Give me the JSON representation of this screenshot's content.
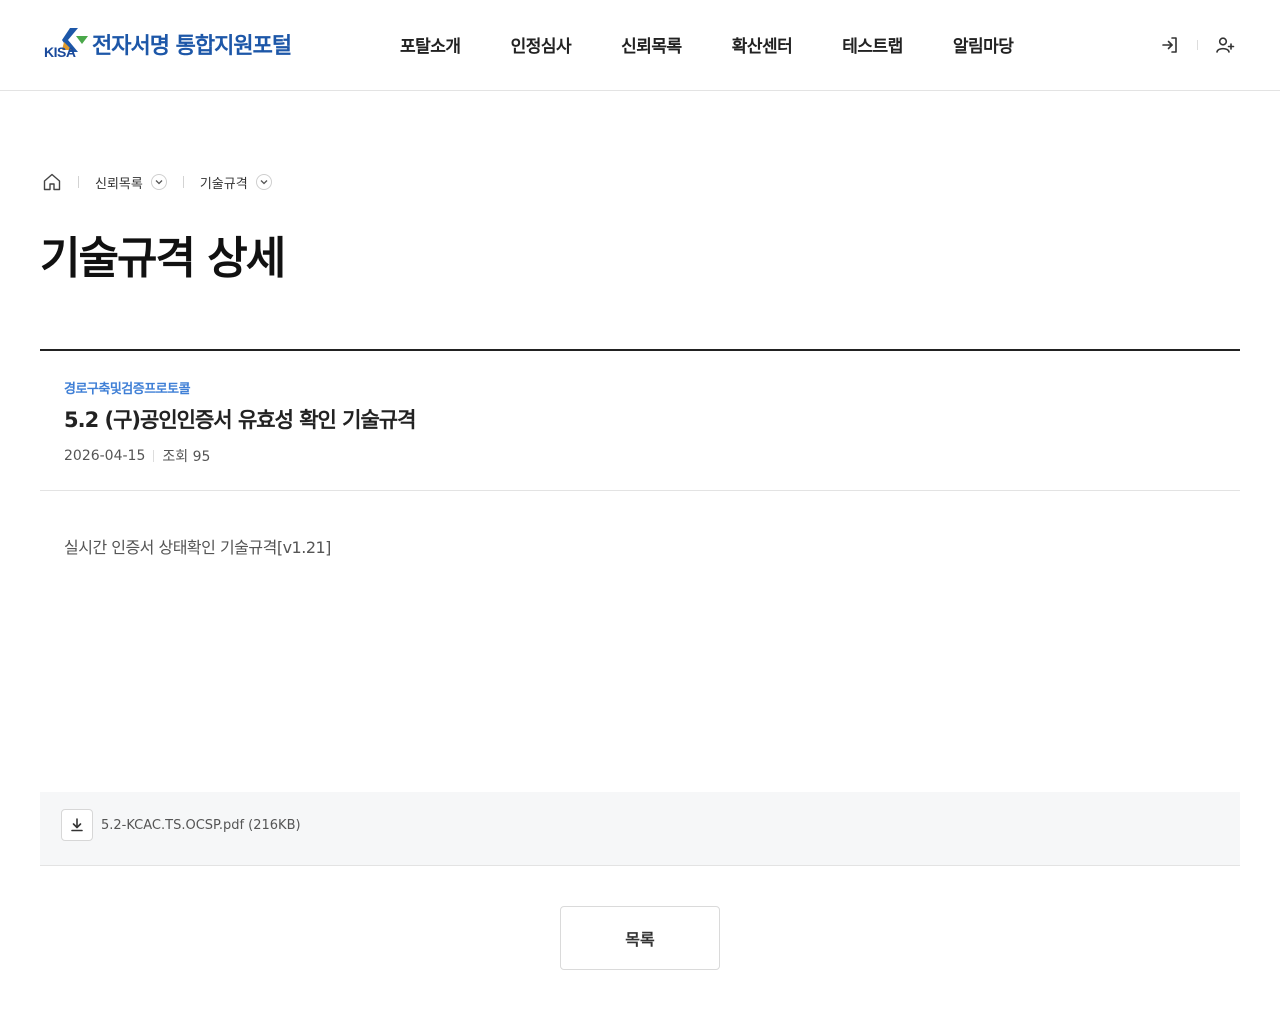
{
  "header": {
    "logo_kisa": "KISA",
    "logo_text": "전자서명 통합지원포털",
    "nav": [
      "포탈소개",
      "인정심사",
      "신뢰목록",
      "확산센터",
      "테스트랩",
      "알림마당"
    ],
    "icons": {
      "login": "login-icon",
      "signup": "user-plus-icon"
    }
  },
  "breadcrumb": {
    "home_icon": "home-icon",
    "items": [
      "신뢰목록",
      "기술규격"
    ]
  },
  "page_title": "기술규격 상세",
  "article": {
    "category": "경로구축및검증프로토콜",
    "title": "5.2 (구)공인인증서 유효성 확인 기술규격",
    "date": "2026-04-15",
    "views": "조회 95",
    "content": "실시간 인증서 상태확인 기술규격[v1.21]"
  },
  "attachment": {
    "icon": "download-icon",
    "name": "5.2-KCAC.TS.OCSP.pdf (216KB)"
  },
  "list_button": "목록",
  "colors": {
    "brand": "#1d57a8",
    "category": "#3f7fd6",
    "attach_bg": "#f6f7f8"
  }
}
